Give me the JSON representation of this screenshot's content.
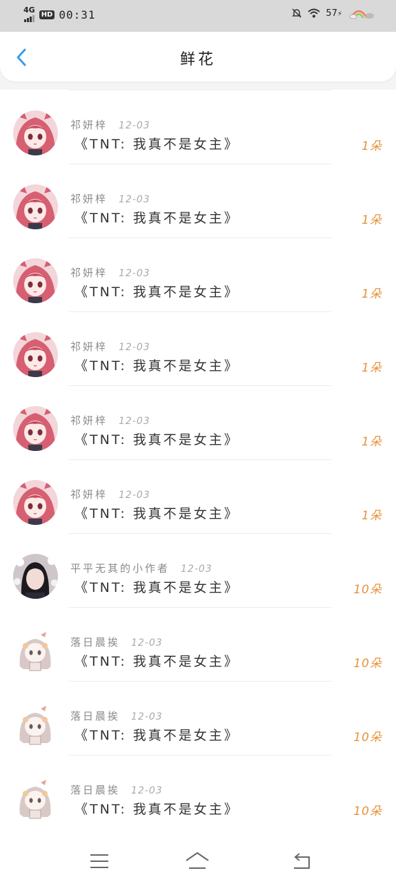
{
  "status_bar": {
    "network": "4G",
    "hd": "HD",
    "time": "00:31",
    "battery": "57"
  },
  "header": {
    "title": "鲜花",
    "back_icon": "chevron-left-icon"
  },
  "colors": {
    "accent_blue": "#3a9ee4",
    "count_orange": "#e8913a"
  },
  "items": [
    {
      "name": "祁妍梓",
      "date": "12-03",
      "book": "《TNT: 我真不是女主》",
      "count": "1朵",
      "avatar": "red-hair-girl"
    },
    {
      "name": "祁妍梓",
      "date": "12-03",
      "book": "《TNT: 我真不是女主》",
      "count": "1朵",
      "avatar": "red-hair-girl"
    },
    {
      "name": "祁妍梓",
      "date": "12-03",
      "book": "《TNT: 我真不是女主》",
      "count": "1朵",
      "avatar": "red-hair-girl"
    },
    {
      "name": "祁妍梓",
      "date": "12-03",
      "book": "《TNT: 我真不是女主》",
      "count": "1朵",
      "avatar": "red-hair-girl"
    },
    {
      "name": "祁妍梓",
      "date": "12-03",
      "book": "《TNT: 我真不是女主》",
      "count": "1朵",
      "avatar": "red-hair-girl"
    },
    {
      "name": "祁妍梓",
      "date": "12-03",
      "book": "《TNT: 我真不是女主》",
      "count": "1朵",
      "avatar": "red-hair-girl"
    },
    {
      "name": "平平无其的小作者",
      "date": "12-03",
      "book": "《TNT: 我真不是女主》",
      "count": "10朵",
      "avatar": "photo-girl"
    },
    {
      "name": "落日晨挨",
      "date": "12-03",
      "book": "《TNT: 我真不是女主》",
      "count": "10朵",
      "avatar": "chibi-girl"
    },
    {
      "name": "落日晨挨",
      "date": "12-03",
      "book": "《TNT: 我真不是女主》",
      "count": "10朵",
      "avatar": "chibi-girl"
    },
    {
      "name": "落日晨挨",
      "date": "12-03",
      "book": "《TNT: 我真不是女主》",
      "count": "10朵",
      "avatar": "chibi-girl"
    }
  ],
  "nav": {
    "menu_icon": "menu-icon",
    "home_icon": "home-icon",
    "back_icon": "return-icon"
  }
}
